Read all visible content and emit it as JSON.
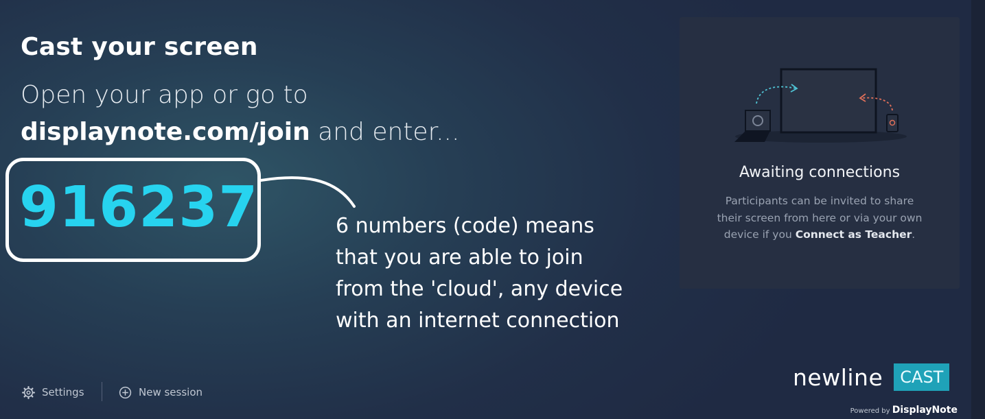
{
  "main": {
    "title": "Cast your screen",
    "instruction_line1": "Open your app or go to",
    "instruction_url": "displaynote.com/join",
    "instruction_suffix": " and enter...",
    "code": "916237"
  },
  "annotation": {
    "lines": [
      "6 numbers (code) means",
      "that you are able to join",
      "from the 'cloud', any device",
      "with an internet connection"
    ]
  },
  "panel": {
    "title": "Awaiting connections",
    "desc_line1": "Participants can be invited to share",
    "desc_line2": "their screen from here or via your own",
    "desc_line3_prefix": "device if you ",
    "desc_line3_bold": "Connect as Teacher",
    "desc_line3_suffix": ".",
    "illustration_icon": "cast-devices-icon"
  },
  "footer": {
    "settings_label": "Settings",
    "new_session_label": "New session"
  },
  "brand": {
    "name": "newline",
    "cast": "CAST",
    "powered_by": "Powered by",
    "displaynote": "DisplayNote"
  },
  "colors": {
    "code": "#27d3ef",
    "cast_badge": "#1fa2b8",
    "panel_bg": "#262f42",
    "left_arrow": "#4fc3d4",
    "right_arrow": "#e0705a"
  }
}
